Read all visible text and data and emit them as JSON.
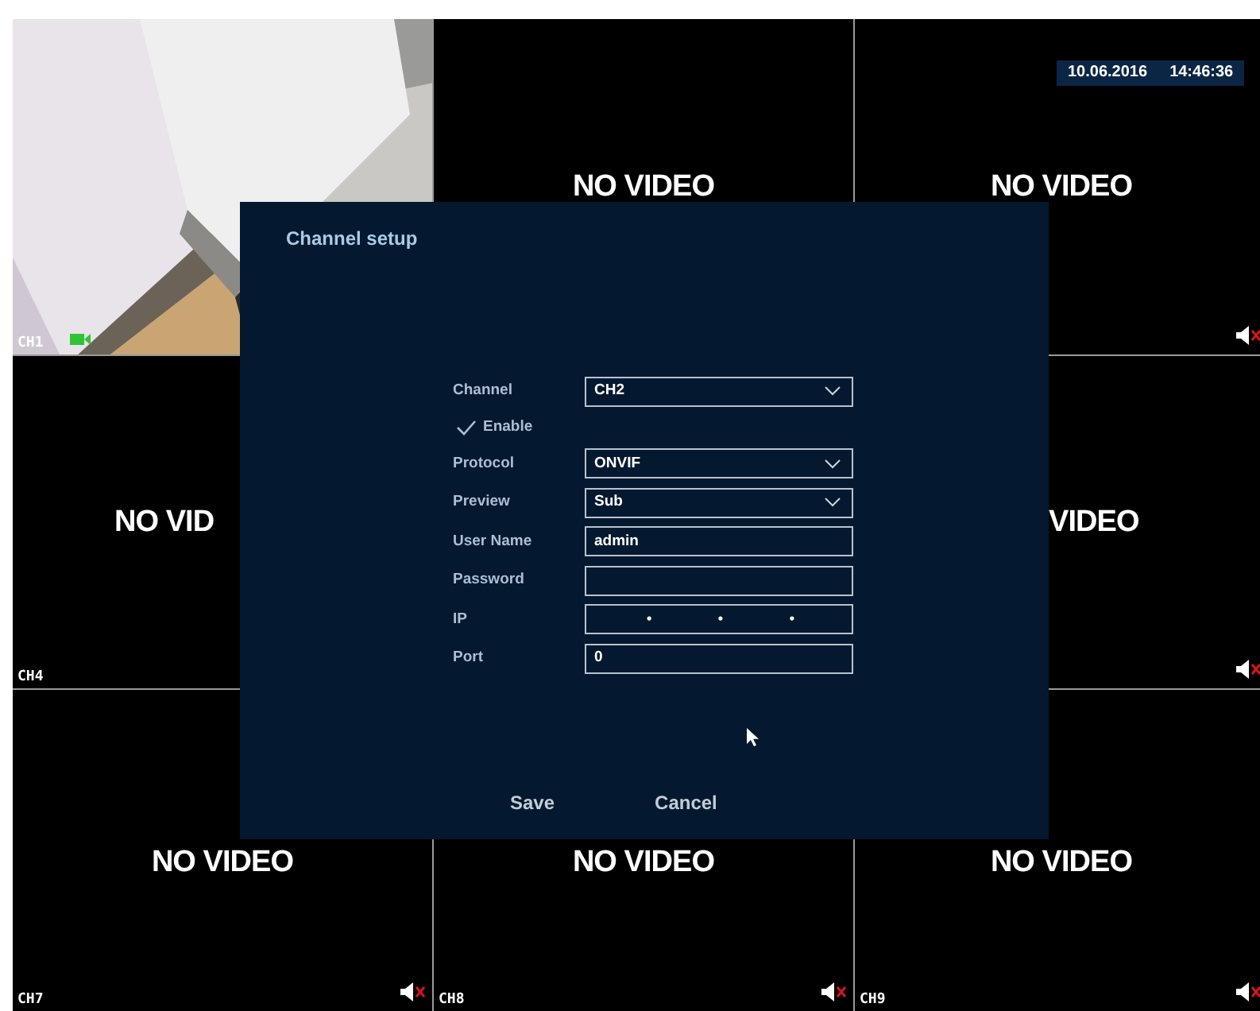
{
  "cells": [
    {
      "kind": "picture",
      "label": "CH1",
      "recording": true
    },
    {
      "kind": "no_video",
      "message": "NO VIDEO"
    },
    {
      "kind": "no_video",
      "message": "NO VIDEO",
      "datetime": {
        "date": "10.06.2016",
        "time": "14:46:36"
      },
      "muted": true
    },
    {
      "kind": "no_video",
      "message": "NO VID",
      "label": "CH4"
    },
    {
      "kind": "covered"
    },
    {
      "kind": "no_video",
      "message": "VIDEO",
      "muted": true
    },
    {
      "kind": "no_video",
      "message": "NO VIDEO",
      "label": "CH7",
      "muted": true
    },
    {
      "kind": "no_video",
      "message": "NO VIDEO",
      "label": "CH8",
      "muted": true
    },
    {
      "kind": "no_video",
      "message": "NO VIDEO",
      "label": "CH9",
      "muted": true
    }
  ],
  "dialog": {
    "title": "Channel setup",
    "fields": [
      {
        "kind": "select",
        "label": "Channel",
        "value": "CH2"
      },
      {
        "kind": "checkbox",
        "label": "Enable",
        "checked": true
      },
      {
        "kind": "select",
        "label": "Protocol",
        "value": "ONVIF"
      },
      {
        "kind": "select",
        "label": "Preview",
        "value": "Sub"
      },
      {
        "kind": "text",
        "label": "User Name",
        "value": "admin"
      },
      {
        "kind": "password",
        "label": "Password"
      },
      {
        "kind": "ip",
        "label": "IP",
        "separators": [
          "•",
          "•",
          "•"
        ]
      },
      {
        "kind": "text",
        "label": "Port",
        "value": "0"
      }
    ],
    "buttons": [
      "Save",
      "Cancel"
    ]
  }
}
